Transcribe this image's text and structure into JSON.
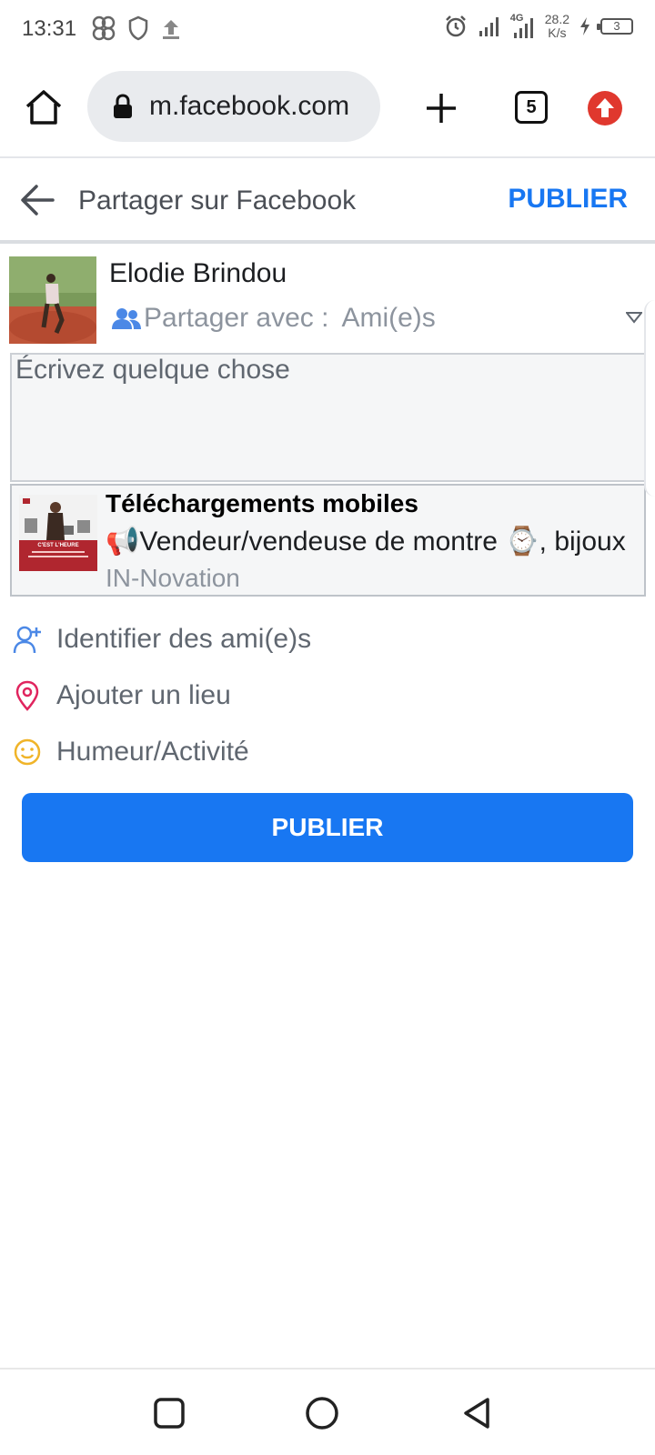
{
  "status_bar": {
    "time": "13:31",
    "network_speed_value": "28.2",
    "network_speed_unit": "K/s",
    "battery_level": "3",
    "network_type": "4G",
    "icons": [
      "pinwheel-icon",
      "shield-icon",
      "upload-icon",
      "alarm-icon",
      "signal-icon",
      "signal-4g-icon",
      "charging-icon",
      "battery-icon"
    ]
  },
  "browser": {
    "url": "m.facebook.com",
    "tab_count": "5",
    "icons": [
      "home-icon",
      "lock-icon",
      "plus-icon",
      "tabs-icon",
      "update-icon"
    ]
  },
  "header": {
    "title": "Partager sur Facebook",
    "publish_label": "PUBLIER"
  },
  "composer": {
    "user_name": "Elodie Brindou",
    "audience_label": "Partager avec :",
    "audience_value": "Ami(e)s",
    "input_placeholder": "Écrivez quelque chose"
  },
  "link_preview": {
    "title": "Téléchargements mobiles",
    "description": "📢Vendeur/vendeuse de montre ⌚, bijoux",
    "source": "IN-Novation",
    "thumb_caption": "C'EST L'HEURE"
  },
  "actions": [
    {
      "label": "Identifier des ami(e)s",
      "icon": "tag-friends-icon",
      "color": "#4b88e6"
    },
    {
      "label": "Ajouter un lieu",
      "icon": "location-pin-icon",
      "color": "#e0245e"
    },
    {
      "label": "Humeur/Activité",
      "icon": "smiley-icon",
      "color": "#f0b429"
    }
  ],
  "publish_button_label": "PUBLIER",
  "colors": {
    "accent": "#1877f2",
    "text_muted": "#8d949e"
  }
}
